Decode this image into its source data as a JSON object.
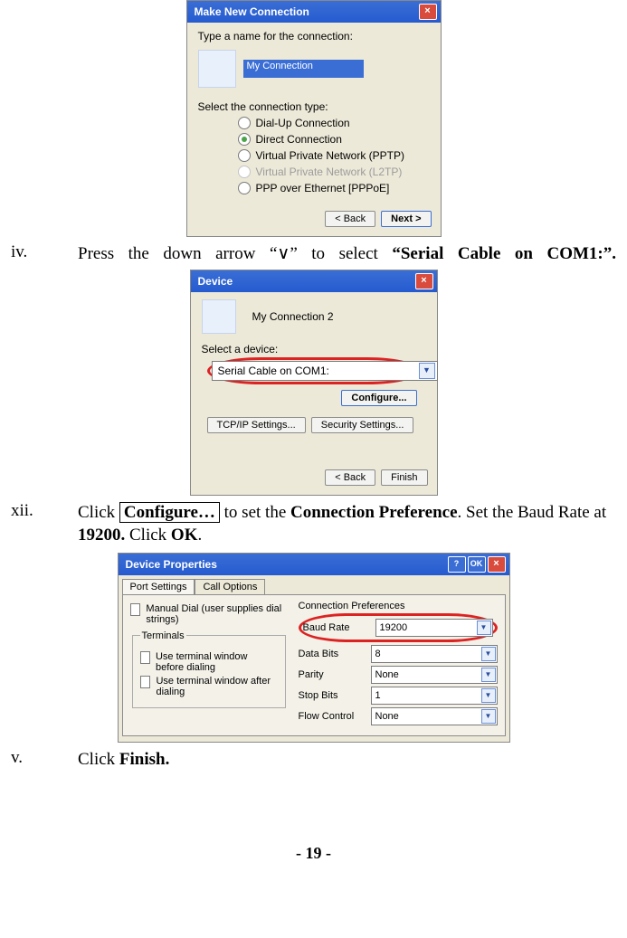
{
  "dlg1": {
    "title": "Make New Connection",
    "prompt_name": "Type a name for the connection:",
    "name_value": "My Connection",
    "prompt_type": "Select the connection type:",
    "options": [
      {
        "label": "Dial-Up Connection",
        "selected": false
      },
      {
        "label": "Direct Connection",
        "selected": true
      },
      {
        "label": "Virtual Private Network (PPTP)",
        "selected": false
      },
      {
        "label": "Virtual Private Network (L2TP)",
        "selected": false,
        "disabled": true
      },
      {
        "label": "PPP over Ethernet [PPPoE]",
        "selected": false
      }
    ],
    "back": "< Back",
    "next": "Next >"
  },
  "step_iv": {
    "num": "iv.",
    "pre": "Press the down arrow “",
    "arrow": "∨",
    "mid": "”  to select ",
    "bold": "“Serial Cable on COM1:”."
  },
  "dlg2": {
    "title": "Device",
    "conn_name": "My Connection 2",
    "select_device": "Select a device:",
    "device_value": "Serial Cable on COM1:",
    "configure": "Configure...",
    "tcpip": "TCP/IP Settings...",
    "security": "Security Settings...",
    "back": "< Back",
    "finish": "Finish"
  },
  "step_xii": {
    "num": "xii.",
    "p1a": "Click ",
    "p1b": "Configure…",
    "p1c": "  to set the ",
    "p1d": "Connection Preference",
    "p1e": ". Set the Baud Rate at ",
    "p1f": "19200.",
    "p1g": "  Click ",
    "p1h": "OK",
    "p1i": "."
  },
  "dlg3": {
    "title": "Device Properties",
    "help": "?",
    "ok": "OK",
    "tabs": {
      "t1": "Port Settings",
      "t2": "Call Options"
    },
    "manual_dial": "Manual Dial (user supplies dial strings)",
    "terminals_legend": "Terminals",
    "term_before": "Use terminal window before dialing",
    "term_after": "Use terminal window after dialing",
    "prefs_legend": "Connection Preferences",
    "rows": {
      "baud": {
        "lbl": "Baud Rate",
        "val": "19200"
      },
      "databits": {
        "lbl": "Data Bits",
        "val": "8"
      },
      "parity": {
        "lbl": "Parity",
        "val": "None"
      },
      "stopbits": {
        "lbl": "Stop Bits",
        "val": "1"
      },
      "flow": {
        "lbl": "Flow Control",
        "val": "None"
      }
    }
  },
  "step_v": {
    "num": "v.",
    "a": "Click ",
    "b": "Finish."
  },
  "pagenum": "- 19 -"
}
